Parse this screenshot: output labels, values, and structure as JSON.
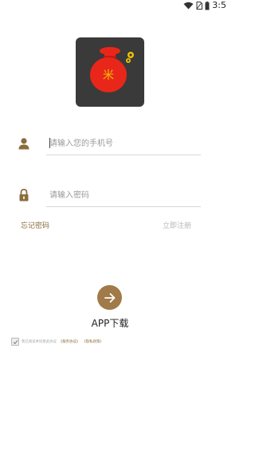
{
  "status_bar": {
    "time": "3:5"
  },
  "login": {
    "phone_placeholder": "请输入您的手机号",
    "password_placeholder": "请输入密码",
    "forgot_password": "忘记密码",
    "register": "立即注册"
  },
  "app_download": "APP下载",
  "agreement": {
    "checked": true,
    "text": "我已阅读并同意此协议",
    "user_agreement": "《服务协议》",
    "privacy_policy": "《隐私政策》"
  },
  "logo": {
    "glyph": "米"
  },
  "colors": {
    "accent": "#a07a48",
    "logo_bg": "#3a3a3a",
    "bag_red": "#e8271a",
    "coin_yellow": "#f2c200"
  },
  "icons": {
    "user": "user-icon",
    "lock": "lock-icon",
    "arrow": "arrow-right-icon",
    "wifi": "wifi-icon",
    "sim": "no-sim-icon",
    "battery": "battery-icon",
    "check": "checkmark-icon"
  }
}
